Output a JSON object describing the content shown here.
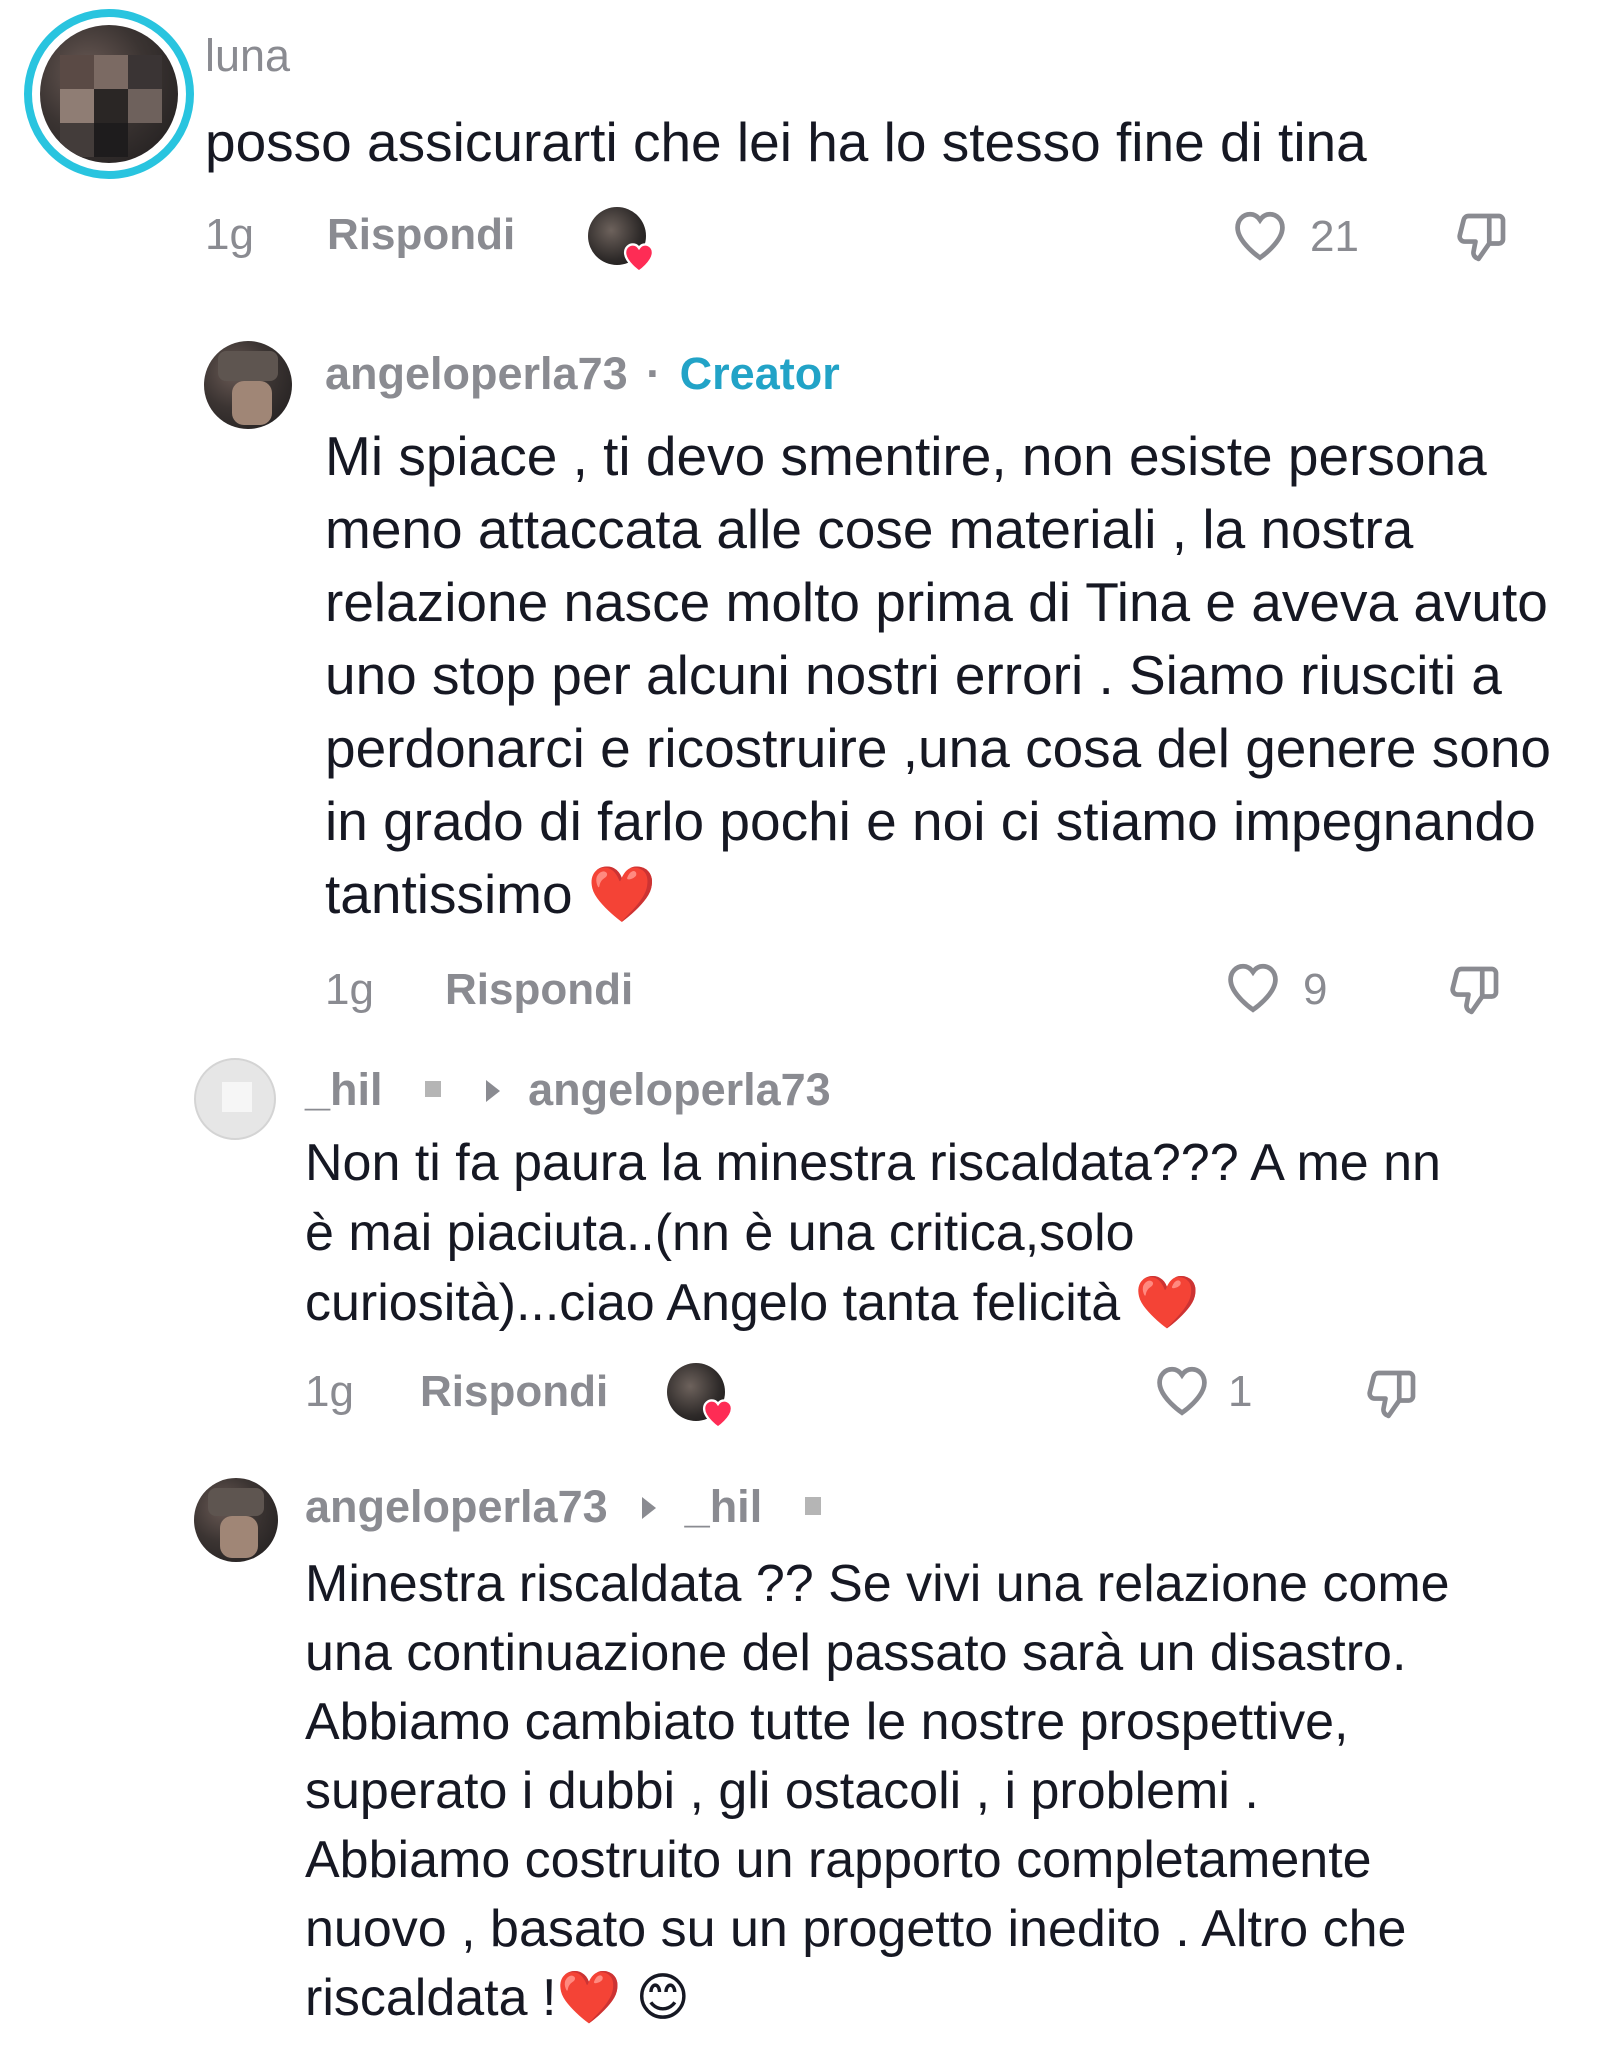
{
  "comments": [
    {
      "username": "luna",
      "text": "posso assicurarti che lei ha lo stesso fine di tina",
      "time": "1g",
      "reply": "Rispondi",
      "likes": "21"
    },
    {
      "username": "angeloperla73",
      "separator": "·",
      "badge": "Creator",
      "text": "Mi spiace , ti devo smentire, non esiste persona meno attaccata alle cose materiali , la nostra relazione nasce molto prima di Tina e aveva avuto uno stop per alcuni nostri errori . Siamo riusciti a perdonarci e ricostruire ,una cosa del genere sono in grado di farlo pochi e noi ci stiamo impegnando tantissimo ❤️",
      "time": "1g",
      "reply": "Rispondi",
      "likes": "9"
    },
    {
      "username": "_hil",
      "reply_to": "angeloperla73",
      "text": "Non ti fa paura la minestra riscaldata??? A me nn è mai piaciuta..(nn è una critica,solo curiosità)...ciao Angelo tanta felicità ❤️",
      "time": "1g",
      "reply": "Rispondi",
      "likes": "1"
    },
    {
      "username": "angeloperla73",
      "reply_to": "_hil",
      "text": "Minestra riscaldata ?? Se vivi una relazione come una continuazione del passato sarà un disastro. Abbiamo cambiato tutte le nostre prospettive, superato i dubbi , gli ostacoli , i problemi . Abbiamo costruito un rapporto completamente nuovo , basato su un progetto inedito . Altro che riscaldata !❤️ 😊"
    }
  ],
  "icons": {
    "like": "heart-outline-icon",
    "dislike": "thumbs-down-icon",
    "creator_liked": "heart-filled-icon"
  },
  "colors": {
    "ring": "#29c4df",
    "creator": "#22a3c7",
    "muted": "#8a8b91",
    "heart": "#fe2c55"
  }
}
